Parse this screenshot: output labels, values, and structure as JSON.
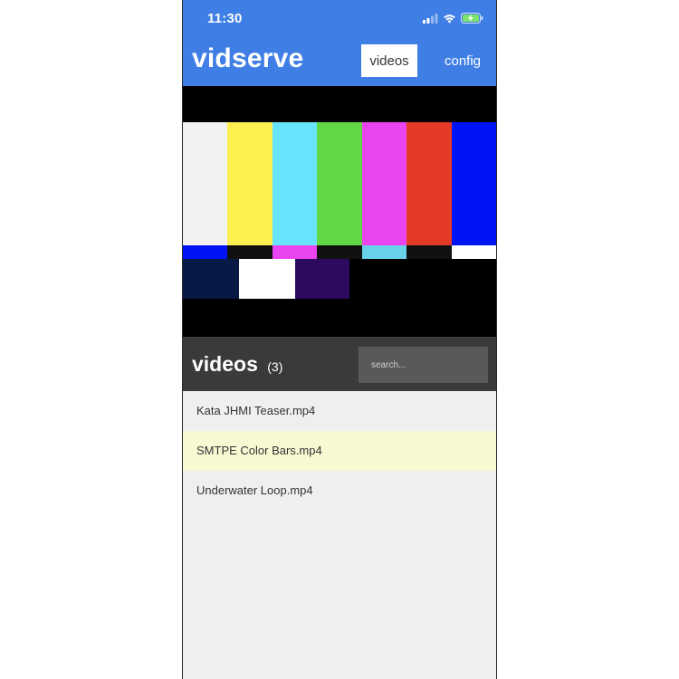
{
  "status_bar": {
    "time": "11:30"
  },
  "header": {
    "brand": "vidserve",
    "nav": {
      "videos": "videos",
      "config": "config"
    }
  },
  "player": {
    "colors": {
      "top_bars": [
        "#f2f2f2",
        "#fdf051",
        "#67e3fb",
        "#61d743",
        "#e944ef",
        "#e53a28",
        "#0013f5"
      ],
      "middle_bars": [
        "#0013f5",
        "#111111",
        "#e944ef",
        "#111111",
        "#67d2ea",
        "#111111",
        "#ffffff"
      ],
      "bottom_blocks": [
        "#061a45",
        "#ffffff",
        "#2d0a60"
      ]
    }
  },
  "videos": {
    "title": "videos",
    "count": "(3)",
    "search_placeholder": "search...",
    "items": [
      {
        "name": "Kata JHMI Teaser.mp4",
        "selected": false
      },
      {
        "name": "SMTPE Color Bars.mp4",
        "selected": true
      },
      {
        "name": "Underwater Loop.mp4",
        "selected": false
      }
    ]
  },
  "colors": {
    "brand_blue": "#3f7ee4",
    "list_header": "#3a3a3a",
    "search_bg": "#595959",
    "selected_row": "#f8f8d3",
    "list_bg": "#efefef"
  }
}
